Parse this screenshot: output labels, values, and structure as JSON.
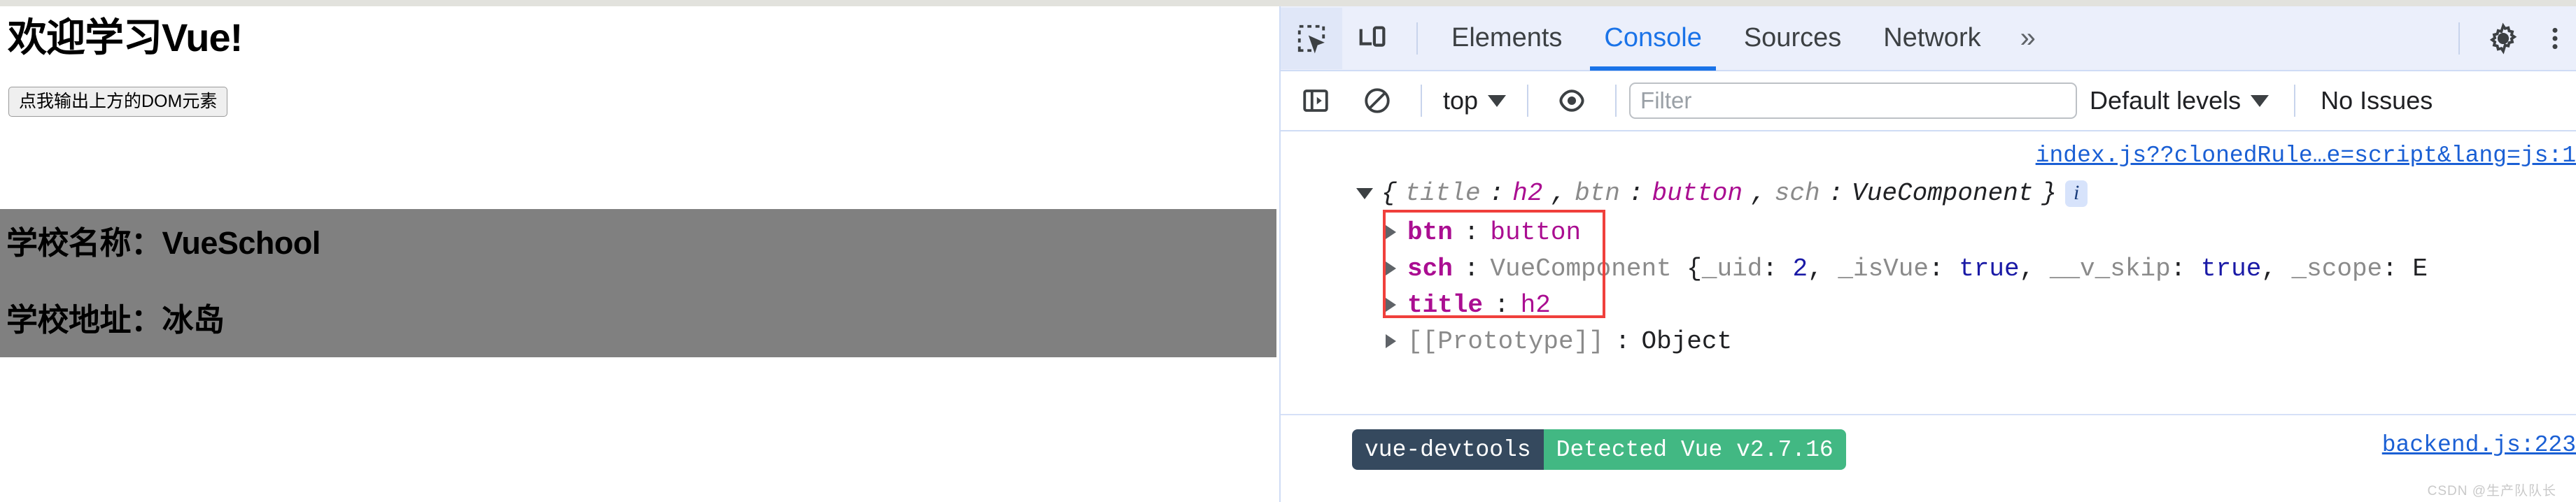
{
  "page": {
    "heading": "欢迎学习Vue!",
    "button_label": "点我输出上方的DOM元素",
    "school_name_line": "学校名称：VueSchool",
    "school_address_line": "学校地址：冰岛",
    "box_color": "#808080"
  },
  "devtools": {
    "toolbar": {
      "inspect_icon": "inspect-element-icon",
      "device_icon": "device-toolbar-icon",
      "tabs": [
        {
          "label": "Elements",
          "active": false
        },
        {
          "label": "Console",
          "active": true
        },
        {
          "label": "Sources",
          "active": false
        },
        {
          "label": "Network",
          "active": false
        }
      ],
      "more_tabs_icon": "chevron-double-right-icon",
      "settings_icon": "gear-icon",
      "menu_icon": "kebab-menu-icon",
      "active_tab_color": "#1a73e8"
    },
    "filterbar": {
      "sidebar_icon": "console-sidebar-icon",
      "clear_icon": "clear-console-icon",
      "context": "top",
      "eye_icon": "live-expression-eye-icon",
      "filter_placeholder": "Filter",
      "filter_value": "",
      "levels": "Default levels",
      "issues": "No Issues"
    },
    "console": {
      "source_link": "index.js??clonedRule…e=script&lang=js:1",
      "preview": {
        "open_brace": "{",
        "parts": [
          {
            "key": "title",
            "sep": ": ",
            "value": "h2",
            "comma": ", "
          },
          {
            "key": "btn",
            "sep": ": ",
            "value": "button",
            "comma": ", "
          },
          {
            "key": "sch",
            "sep": ": ",
            "value": "VueComponent",
            "comma": ""
          }
        ],
        "close_brace": "}",
        "info_badge": "i"
      },
      "properties": [
        {
          "key": "btn",
          "value": "button",
          "value_style": "magenta"
        },
        {
          "key": "sch",
          "value": "VueComponent {_uid: 2, _isVue: true, __v_skip: true, _scope: E",
          "value_style": "object"
        },
        {
          "key": "title",
          "value": "h2",
          "value_style": "magenta"
        },
        {
          "key": "[[Prototype]]",
          "value": "Object",
          "value_style": "proto"
        }
      ],
      "highlight_color": "#f0403c",
      "vue_devtools_badge": {
        "left": "vue-devtools",
        "right": "Detected Vue v2.7.16",
        "left_color": "#35495e",
        "right_color": "#42b883"
      },
      "backend_link": "backend.js:223"
    }
  },
  "watermark": "CSDN @生产队队长"
}
